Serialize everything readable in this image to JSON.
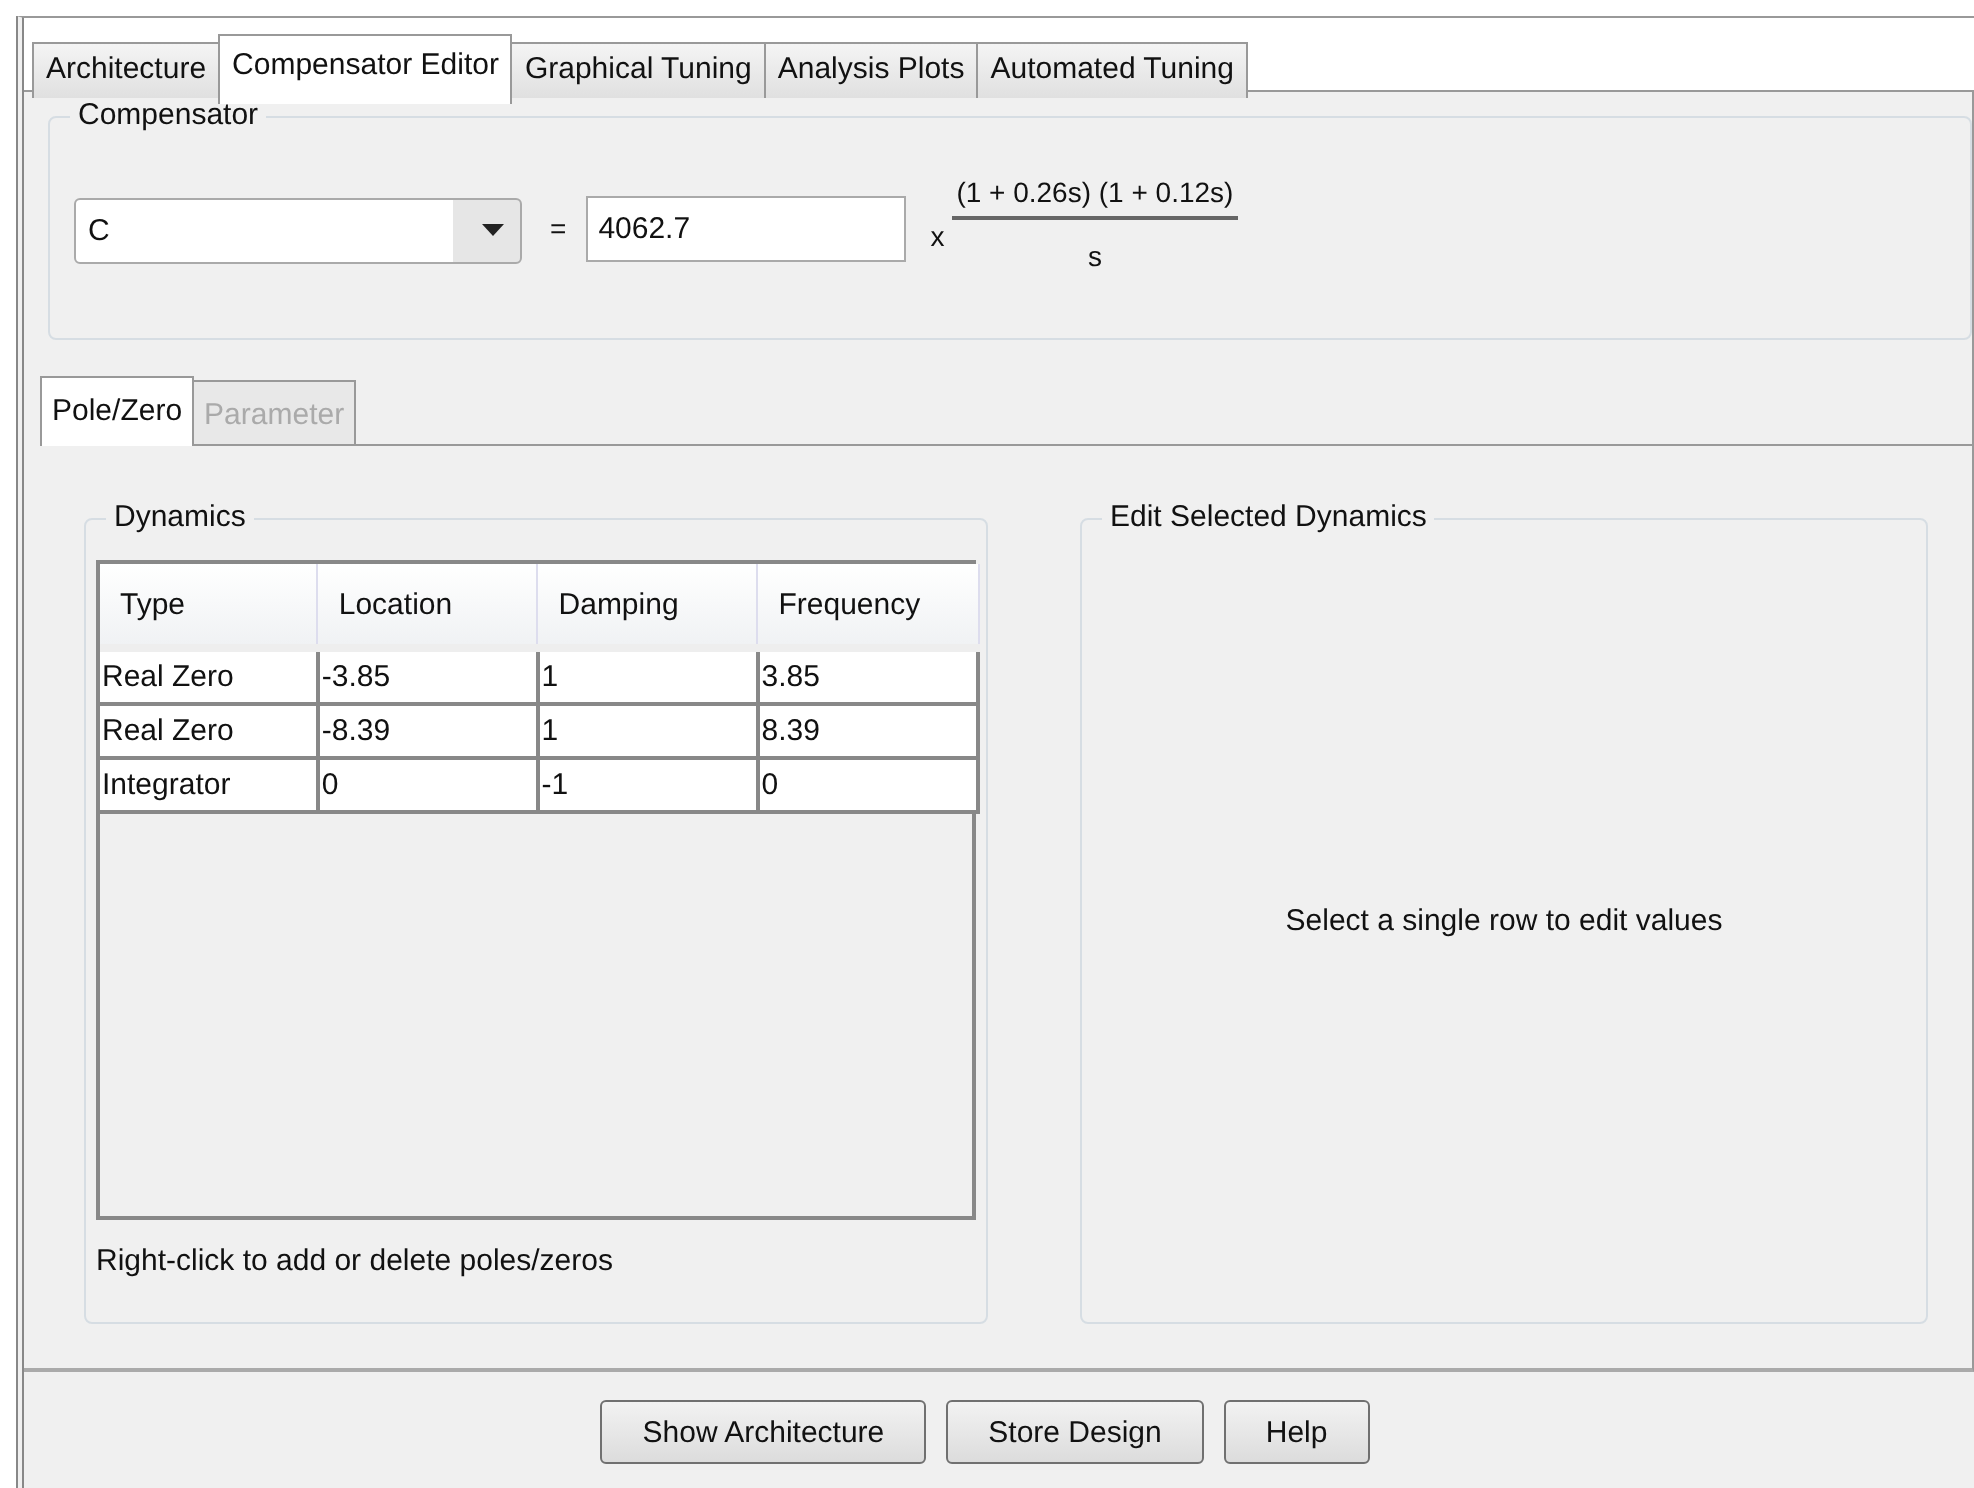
{
  "tabs": [
    {
      "label": "Architecture",
      "selected": false
    },
    {
      "label": "Compensator Editor",
      "selected": true
    },
    {
      "label": "Graphical Tuning",
      "selected": false
    },
    {
      "label": "Analysis Plots",
      "selected": false
    },
    {
      "label": "Automated Tuning",
      "selected": false
    }
  ],
  "compensator": {
    "title": "Compensator",
    "name": "C",
    "equals": "=",
    "gain": "4062.7",
    "times": "x",
    "numerator": "(1 + 0.26s) (1 + 0.12s)",
    "denominator": "s"
  },
  "subtabs": [
    {
      "label": "Pole/Zero",
      "selected": true,
      "disabled": false
    },
    {
      "label": "Parameter",
      "selected": false,
      "disabled": true
    }
  ],
  "dynamics": {
    "title": "Dynamics",
    "columns": [
      "Type",
      "Location",
      "Damping",
      "Frequency"
    ],
    "rows": [
      [
        "Real Zero",
        "-3.85",
        "1",
        "3.85"
      ],
      [
        "Real Zero",
        "-8.39",
        "1",
        "8.39"
      ],
      [
        "Integrator",
        "0",
        "-1",
        "0"
      ]
    ],
    "hint": "Right-click to add or delete poles/zeros"
  },
  "edit": {
    "title": "Edit Selected Dynamics",
    "message": "Select a single row to edit values"
  },
  "buttons": [
    "Show Architecture",
    "Store Design",
    "Help"
  ]
}
